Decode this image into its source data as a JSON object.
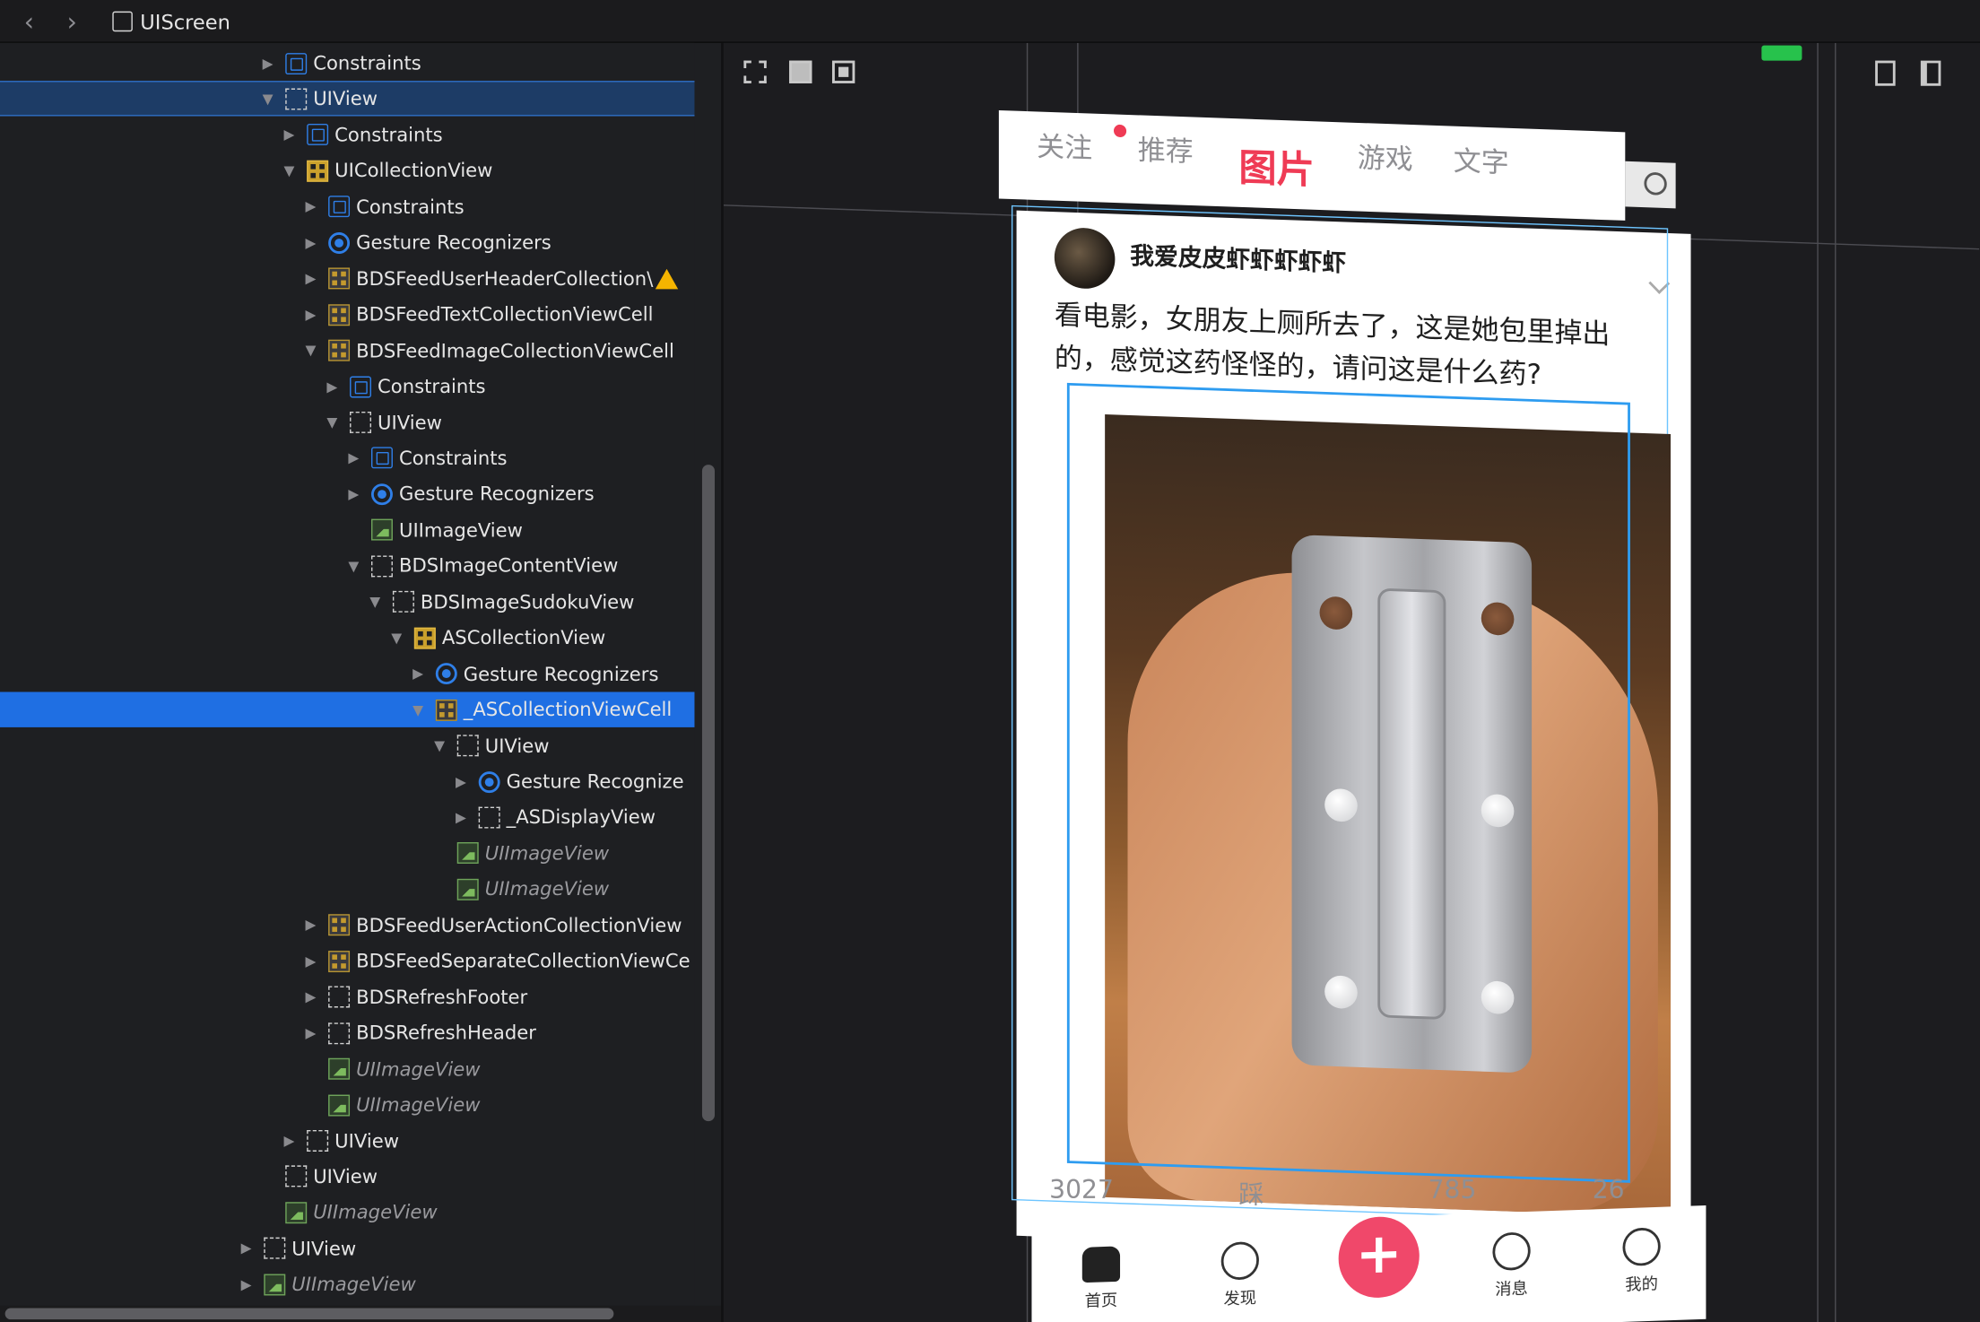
{
  "topbar": {
    "back_icon": "chevron-left-icon",
    "forward_icon": "chevron-right-icon",
    "breadcrumb": "UIScreen"
  },
  "tree": {
    "rows": [
      {
        "label": "Constraints",
        "kind": "constraints",
        "depth": 0
      },
      {
        "label": "UIView",
        "kind": "view",
        "depth": 0,
        "selected": "dim"
      },
      {
        "label": "Constraints",
        "kind": "constraints",
        "depth": 1
      },
      {
        "label": "UICollectionView",
        "kind": "collection",
        "depth": 1
      },
      {
        "label": "Constraints",
        "kind": "constraints",
        "depth": 2
      },
      {
        "label": "Gesture Recognizers",
        "kind": "gesture",
        "depth": 2
      },
      {
        "label": "BDSFeedUserHeaderCollection\\",
        "kind": "cell",
        "depth": 2,
        "warning": true
      },
      {
        "label": "BDSFeedTextCollectionViewCell",
        "kind": "cell",
        "depth": 2
      },
      {
        "label": "BDSFeedImageCollectionViewCell",
        "kind": "cell",
        "depth": 2
      },
      {
        "label": "Constraints",
        "kind": "constraints",
        "depth": 3
      },
      {
        "label": "UIView",
        "kind": "view",
        "depth": 3
      },
      {
        "label": "Constraints",
        "kind": "constraints",
        "depth": 4
      },
      {
        "label": "Gesture Recognizers",
        "kind": "gesture",
        "depth": 4
      },
      {
        "label": "UIImageView",
        "kind": "image",
        "depth": 4
      },
      {
        "label": "BDSImageContentView",
        "kind": "view",
        "depth": 4
      },
      {
        "label": "BDSImageSudokuView",
        "kind": "view",
        "depth": 5
      },
      {
        "label": "ASCollectionView",
        "kind": "collection",
        "depth": 6
      },
      {
        "label": "Gesture Recognizers",
        "kind": "gesture",
        "depth": 7
      },
      {
        "label": "_ASCollectionViewCell",
        "kind": "cell",
        "depth": 7,
        "selected": "full"
      },
      {
        "label": "UIView",
        "kind": "view",
        "depth": 8
      },
      {
        "label": "Gesture Recognize",
        "kind": "gesture",
        "depth": 9
      },
      {
        "label": "_ASDisplayView",
        "kind": "view",
        "depth": 9
      },
      {
        "label": "UIImageView",
        "kind": "image",
        "depth": 8,
        "italic": true
      },
      {
        "label": "UIImageView",
        "kind": "image",
        "depth": 8,
        "italic": true
      },
      {
        "label": "BDSFeedUserActionCollectionView",
        "kind": "cell",
        "depth": 2
      },
      {
        "label": "BDSFeedSeparateCollectionViewCe",
        "kind": "cell",
        "depth": 2
      },
      {
        "label": "BDSRefreshFooter",
        "kind": "view",
        "depth": 2
      },
      {
        "label": "BDSRefreshHeader",
        "kind": "view",
        "depth": 2
      },
      {
        "label": "UIImageView",
        "kind": "image",
        "depth": 2,
        "italic": true
      },
      {
        "label": "UIImageView",
        "kind": "image",
        "depth": 2,
        "italic": true
      },
      {
        "label": "UIView",
        "kind": "view",
        "depth": 1
      },
      {
        "label": "UIView",
        "kind": "view",
        "depth": 0
      },
      {
        "label": "UIImageView",
        "kind": "image",
        "depth": 0,
        "italic": true
      },
      {
        "label": "UIView",
        "kind": "view",
        "depth": -1
      },
      {
        "label": "UIImageView",
        "kind": "image",
        "depth": -1,
        "italic": true
      }
    ]
  },
  "app": {
    "tabs": [
      "关注",
      "推荐",
      "图片",
      "游戏",
      "文字"
    ],
    "active_tab": "图片",
    "username": "我爱皮皮虾虾虾虾虾",
    "post_text": "看电影，女朋友上厕所去了，这是她包里掉出的，感觉这药怪怪的，请问这是什么药?",
    "actions": [
      "3027",
      "踩",
      "785",
      "26"
    ],
    "bottom_tabs": [
      "首页",
      "发现",
      "消息",
      "我的"
    ],
    "plus_label": "+",
    "accent": "#ef3b55"
  },
  "colors": {
    "selection": "#1f6fe3",
    "selection_dim": "#1d3c66",
    "outline": "#2e9cf0"
  }
}
